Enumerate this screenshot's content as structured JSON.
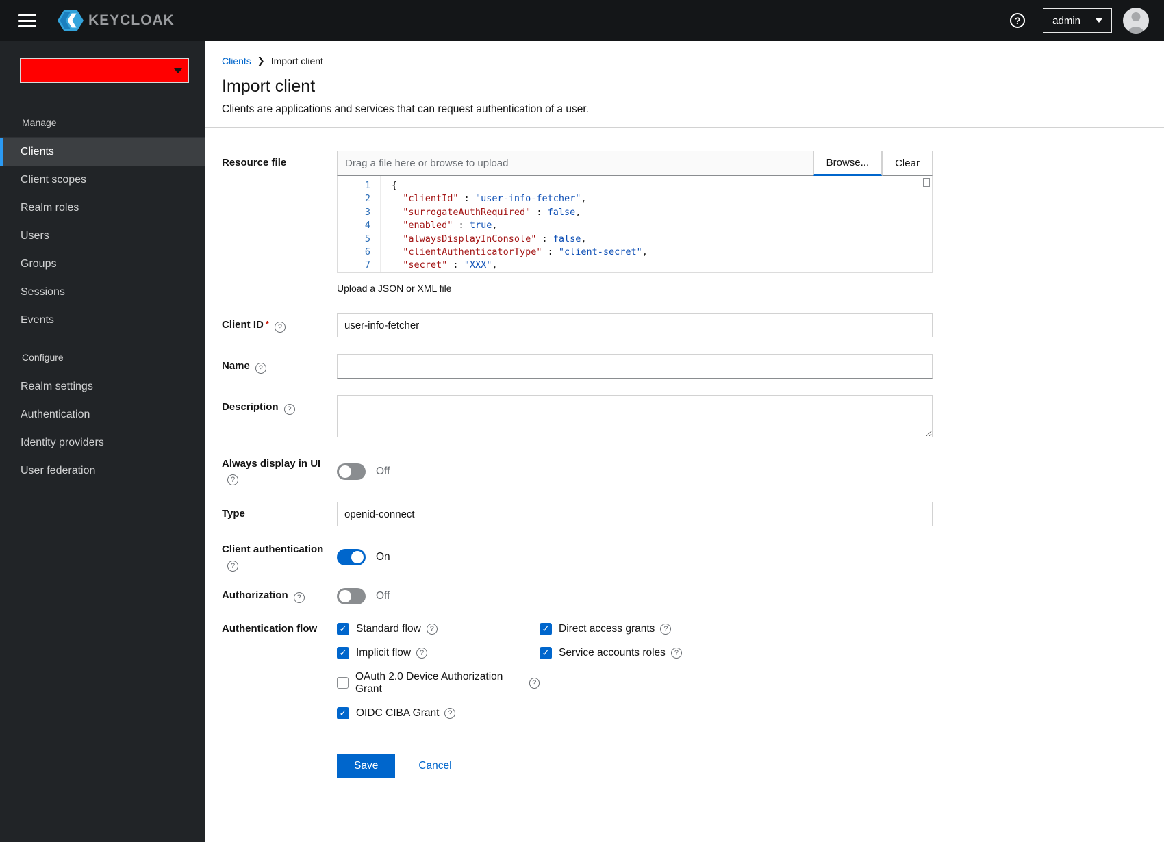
{
  "icons": {
    "help": "?",
    "breadcrumb_separator": "❯",
    "check": "✓"
  },
  "colors": {
    "accent": "#0066cc",
    "realm_indicator": "#ff0000",
    "nav_active_border": "#2b9af3",
    "topbar_bg": "#141618",
    "sidebar_bg": "#212427",
    "code_key": "#a31515",
    "code_value": "#0e4fb5"
  },
  "topbar": {
    "brand": "KEYCLOAK",
    "user_menu": "admin"
  },
  "sidebar": {
    "sections": [
      {
        "header": "Manage",
        "items": [
          {
            "label": "Clients",
            "active": true
          },
          {
            "label": "Client scopes"
          },
          {
            "label": "Realm roles"
          },
          {
            "label": "Users"
          },
          {
            "label": "Groups"
          },
          {
            "label": "Sessions"
          },
          {
            "label": "Events"
          }
        ]
      },
      {
        "header": "Configure",
        "items": [
          {
            "label": "Realm settings"
          },
          {
            "label": "Authentication"
          },
          {
            "label": "Identity providers"
          },
          {
            "label": "User federation"
          }
        ]
      }
    ]
  },
  "breadcrumb": {
    "parent": "Clients",
    "current": "Import client"
  },
  "page": {
    "title": "Import client",
    "subtitle": "Clients are applications and services that can request authentication of a user."
  },
  "form": {
    "resource_file": {
      "label": "Resource file",
      "placeholder": "Drag a file here or browse to upload",
      "browse_label": "Browse...",
      "clear_label": "Clear",
      "helper": "Upload a JSON or XML file",
      "code": [
        {
          "n": 1,
          "tokens": [
            {
              "c": "pln",
              "t": "{"
            }
          ]
        },
        {
          "n": 2,
          "tokens": [
            {
              "c": "pln",
              "t": "  "
            },
            {
              "c": "key",
              "t": "\"clientId\""
            },
            {
              "c": "pln",
              "t": " : "
            },
            {
              "c": "val",
              "t": "\"user-info-fetcher\""
            },
            {
              "c": "pln",
              "t": ","
            }
          ]
        },
        {
          "n": 3,
          "tokens": [
            {
              "c": "pln",
              "t": "  "
            },
            {
              "c": "key",
              "t": "\"surrogateAuthRequired\""
            },
            {
              "c": "pln",
              "t": " : "
            },
            {
              "c": "val",
              "t": "false"
            },
            {
              "c": "pln",
              "t": ","
            }
          ]
        },
        {
          "n": 4,
          "tokens": [
            {
              "c": "pln",
              "t": "  "
            },
            {
              "c": "key",
              "t": "\"enabled\""
            },
            {
              "c": "pln",
              "t": " : "
            },
            {
              "c": "val",
              "t": "true"
            },
            {
              "c": "pln",
              "t": ","
            }
          ]
        },
        {
          "n": 5,
          "tokens": [
            {
              "c": "pln",
              "t": "  "
            },
            {
              "c": "key",
              "t": "\"alwaysDisplayInConsole\""
            },
            {
              "c": "pln",
              "t": " : "
            },
            {
              "c": "val",
              "t": "false"
            },
            {
              "c": "pln",
              "t": ","
            }
          ]
        },
        {
          "n": 6,
          "tokens": [
            {
              "c": "pln",
              "t": "  "
            },
            {
              "c": "key",
              "t": "\"clientAuthenticatorType\""
            },
            {
              "c": "pln",
              "t": " : "
            },
            {
              "c": "val",
              "t": "\"client-secret\""
            },
            {
              "c": "pln",
              "t": ","
            }
          ]
        },
        {
          "n": 7,
          "tokens": [
            {
              "c": "pln",
              "t": "  "
            },
            {
              "c": "key",
              "t": "\"secret\""
            },
            {
              "c": "pln",
              "t": " : "
            },
            {
              "c": "val",
              "t": "\"XXX\""
            },
            {
              "c": "pln",
              "t": ","
            }
          ]
        }
      ]
    },
    "client_id": {
      "label": "Client ID",
      "required": "*",
      "value": "user-info-fetcher"
    },
    "name": {
      "label": "Name",
      "value": ""
    },
    "description": {
      "label": "Description",
      "value": ""
    },
    "always_display": {
      "label": "Always display in UI",
      "state": "Off"
    },
    "type": {
      "label": "Type",
      "value": "openid-connect"
    },
    "client_auth": {
      "label": "Client authentication",
      "state": "On"
    },
    "authorization": {
      "label": "Authorization",
      "state": "Off"
    },
    "auth_flow": {
      "label": "Authentication flow",
      "options": [
        {
          "label": "Standard flow",
          "checked": true
        },
        {
          "label": "Direct access grants",
          "checked": true
        },
        {
          "label": "Implicit flow",
          "checked": true
        },
        {
          "label": "Service accounts roles",
          "checked": true
        },
        {
          "label": "OAuth 2.0 Device Authorization Grant",
          "checked": false
        },
        {
          "label": "OIDC CIBA Grant",
          "checked": true
        }
      ]
    },
    "actions": {
      "save": "Save",
      "cancel": "Cancel"
    }
  }
}
